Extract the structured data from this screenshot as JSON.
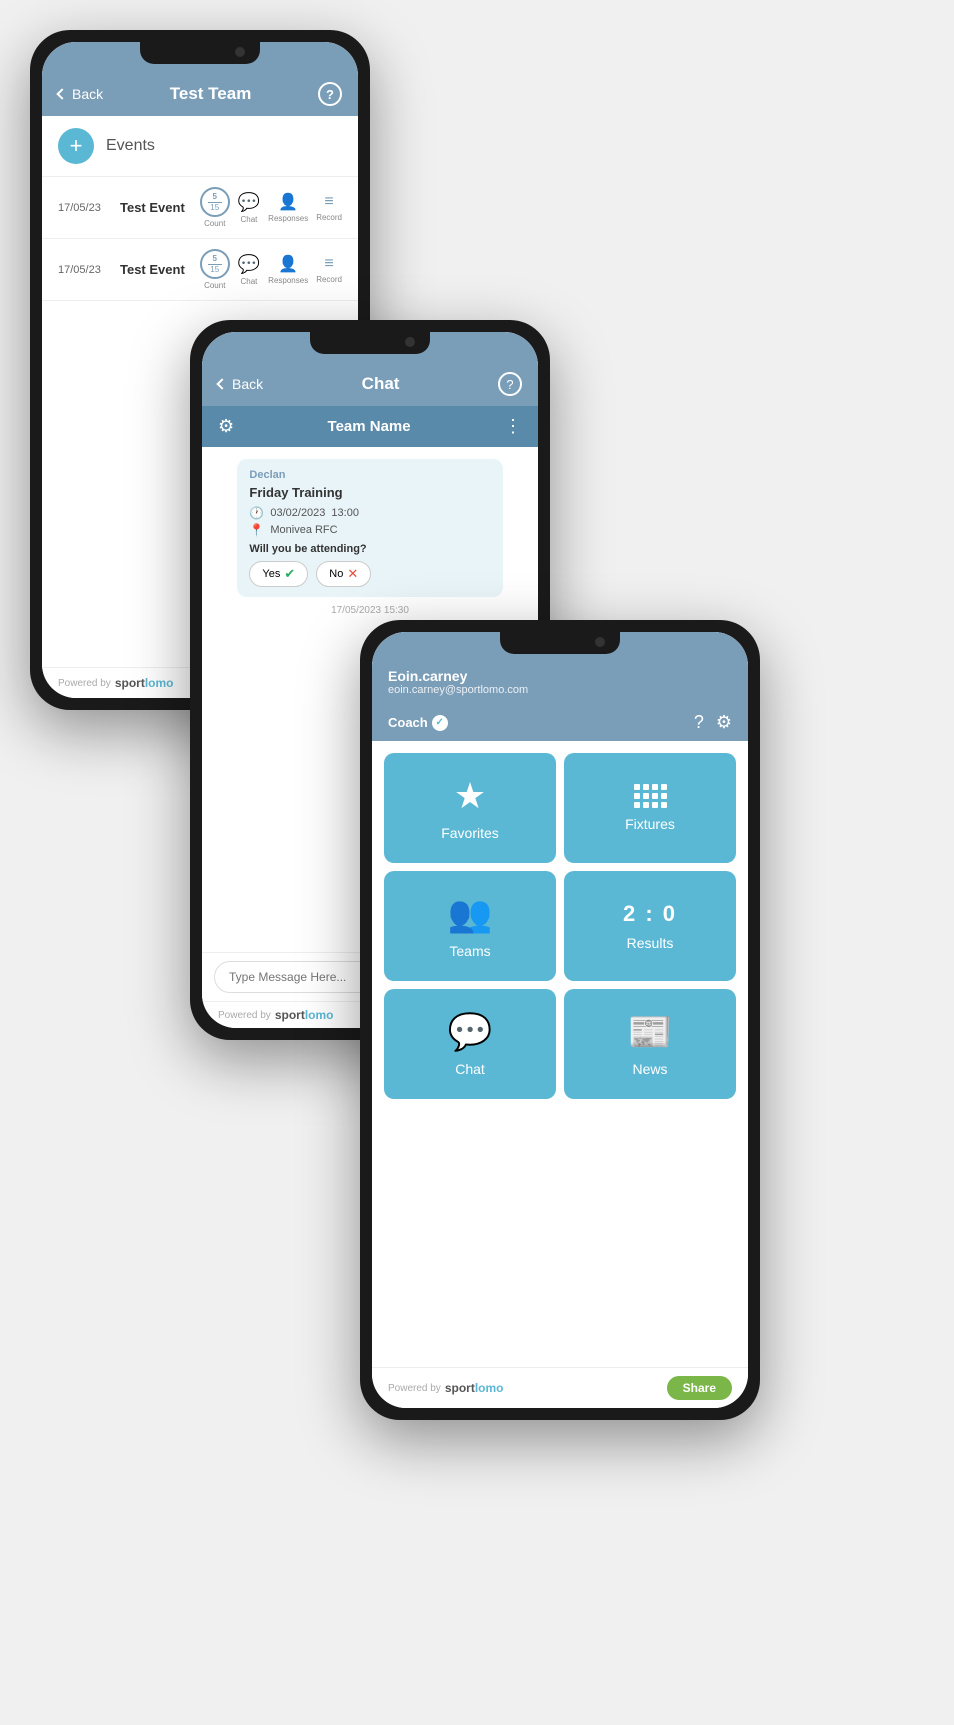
{
  "phone1": {
    "header": {
      "back_label": "Back",
      "title": "Test Team",
      "help_label": "?"
    },
    "add_section": {
      "label": "Events"
    },
    "events": [
      {
        "date": "17/05/23",
        "name": "Test Event",
        "count_top": "5",
        "count_bot": "15",
        "count_label": "Count",
        "chat_label": "Chat",
        "responses_label": "Responses",
        "record_label": "Record"
      },
      {
        "date": "17/05/23",
        "name": "Test Event",
        "count_top": "5",
        "count_bot": "15",
        "count_label": "Count",
        "chat_label": "Chat",
        "responses_label": "Responses",
        "record_label": "Record"
      }
    ],
    "footer": {
      "powered_by": "Powered by",
      "brand": "sportlomo"
    }
  },
  "phone2": {
    "header": {
      "back_label": "Back",
      "title": "Chat",
      "help_label": "?"
    },
    "team_bar": {
      "team_name": "Team Name"
    },
    "message": {
      "sender": "Declan",
      "event_title": "Friday Training",
      "date": "03/02/2023",
      "time": "13:00",
      "location": "Monivea RFC",
      "question": "Will you be attending?",
      "yes_label": "Yes",
      "no_label": "No",
      "timestamp": "17/05/2023 15:30"
    },
    "input_placeholder": "Type Message Here...",
    "footer": {
      "powered_by": "Powered by",
      "brand": "sportlomo"
    }
  },
  "phone3": {
    "user": {
      "name": "Eoin.carney",
      "email": "eoin.carney@sportlomo.com",
      "role": "Coach"
    },
    "tiles": [
      {
        "id": "favorites",
        "label": "Favorites",
        "icon_type": "star"
      },
      {
        "id": "fixtures",
        "label": "Fixtures",
        "icon_type": "calendar"
      },
      {
        "id": "teams",
        "label": "Teams",
        "icon_type": "people"
      },
      {
        "id": "results",
        "label": "Results",
        "icon_type": "score"
      },
      {
        "id": "chat",
        "label": "Chat",
        "icon_type": "chat"
      },
      {
        "id": "news",
        "label": "News",
        "icon_type": "news"
      }
    ],
    "results_score": "2 : 0",
    "footer": {
      "powered_by": "Powered by",
      "brand": "sportlomo",
      "share_label": "Share"
    }
  }
}
